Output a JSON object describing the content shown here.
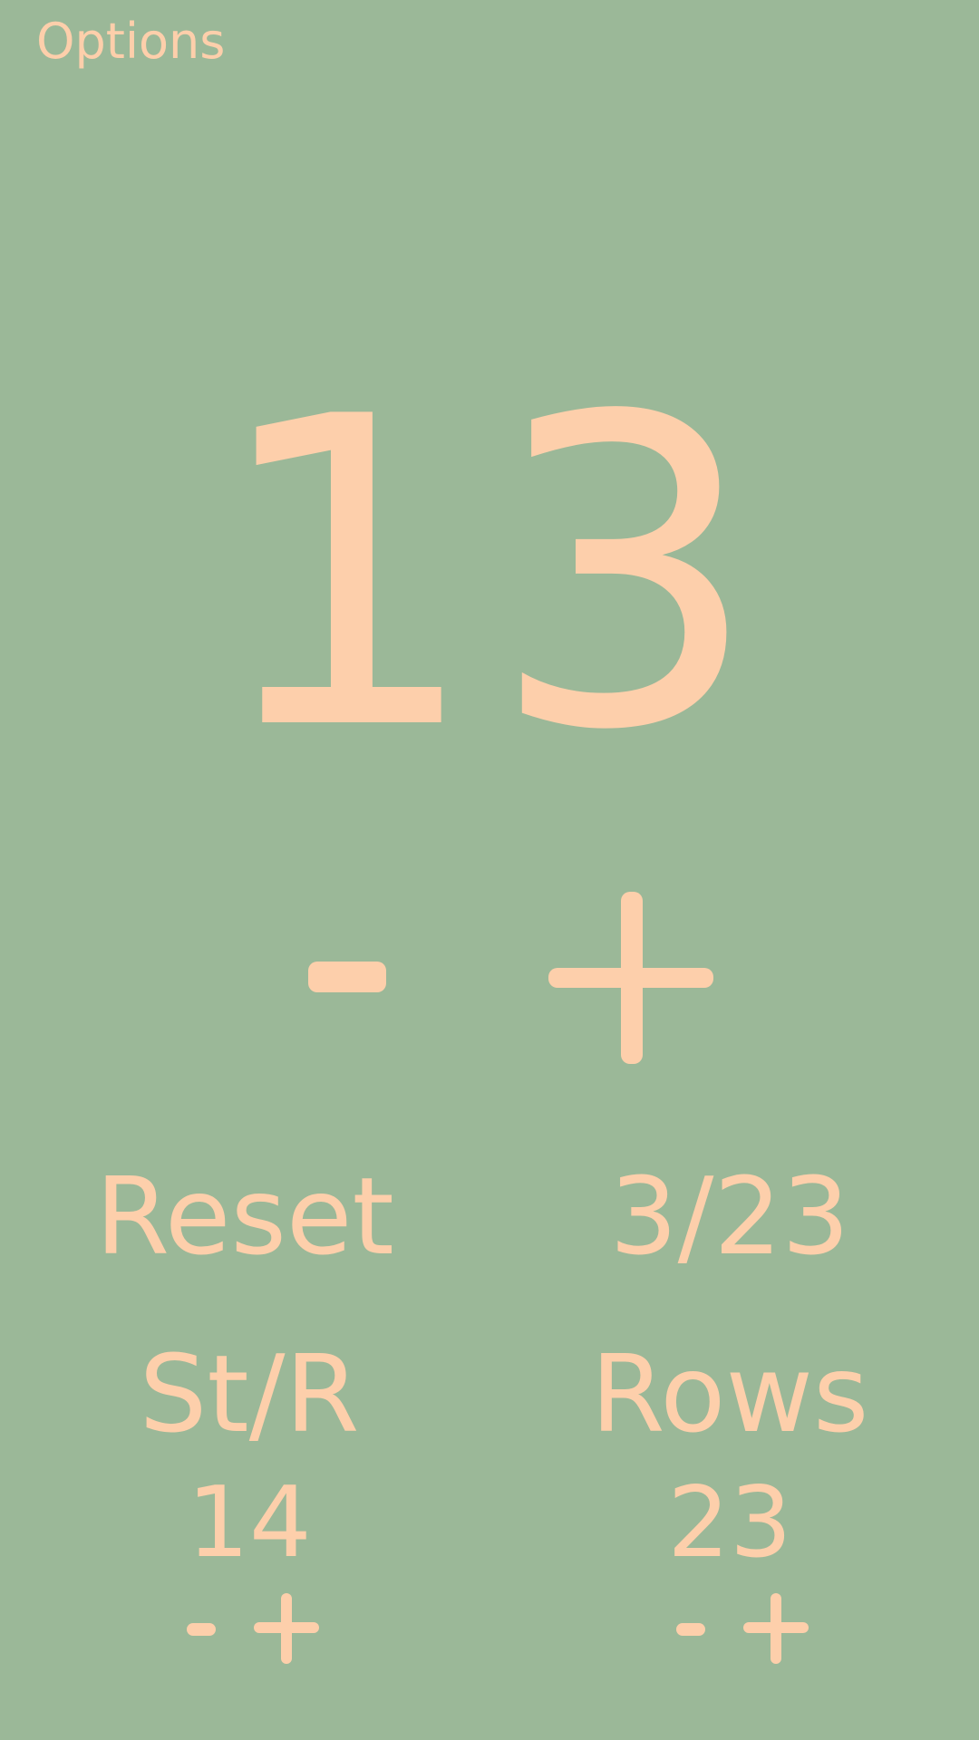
{
  "header": {
    "options_label": "Options"
  },
  "counter": {
    "value": "13"
  },
  "actions": {
    "reset_label": "Reset",
    "progress": "3/23"
  },
  "stitches_per_row": {
    "label": "St/R",
    "value": "14"
  },
  "rows": {
    "label": "Rows",
    "value": "23"
  },
  "colors": {
    "background": "#9bb898",
    "foreground": "#fdcfab"
  },
  "icons": {
    "decrement": "minus-icon",
    "increment": "plus-icon"
  }
}
